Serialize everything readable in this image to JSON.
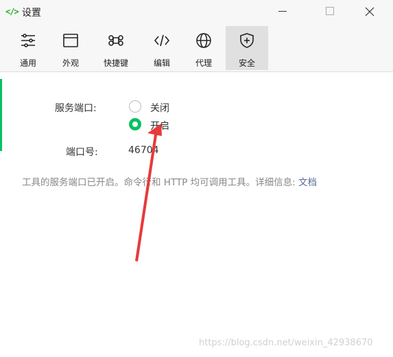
{
  "window": {
    "title": "设置",
    "app_icon": "</>"
  },
  "toolbar": {
    "items": [
      {
        "label": "通用",
        "icon": "sliders-icon"
      },
      {
        "label": "外观",
        "icon": "window-icon"
      },
      {
        "label": "快捷键",
        "icon": "command-icon"
      },
      {
        "label": "编辑",
        "icon": "code-icon"
      },
      {
        "label": "代理",
        "icon": "globe-icon"
      },
      {
        "label": "安全",
        "icon": "shield-icon",
        "active": true
      }
    ]
  },
  "security": {
    "service_port_label": "服务端口:",
    "option_close": "关闭",
    "option_open": "开启",
    "selected": "开启",
    "port_number_label": "端口号:",
    "port_number_value": "46704",
    "note_text": "工具的服务端口已开启。命令行和 HTTP 均可调用工具。详细信息: ",
    "note_link": "文档"
  },
  "watermark": "https://blog.csdn.net/weixin_42938670",
  "colors": {
    "accent": "#07c160",
    "link": "#576b95",
    "annotation_arrow": "#e83a3a"
  }
}
